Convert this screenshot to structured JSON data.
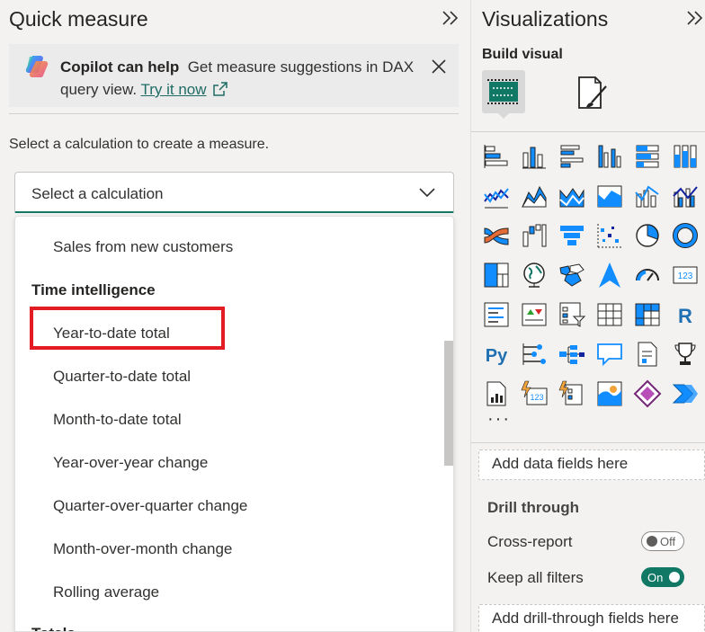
{
  "quick_measure": {
    "title": "Quick measure",
    "collapse_glyph": "»",
    "copilot": {
      "bold": "Copilot can help",
      "text": "Get measure suggestions in DAX query view.",
      "link": "Try it now"
    },
    "instruction": "Select a calculation to create a measure.",
    "select_placeholder": "Select a calculation",
    "list": {
      "items_top": [
        "Sales from new customers"
      ],
      "group_time": "Time intelligence",
      "time_items": [
        "Year-to-date total",
        "Quarter-to-date total",
        "Month-to-date total",
        "Year-over-year change",
        "Quarter-over-quarter change",
        "Month-over-month change",
        "Rolling average"
      ],
      "group_totals": "Totals",
      "highlighted": "Year-to-date total"
    }
  },
  "visualizations": {
    "title": "Visualizations",
    "collapse_glyph": "»",
    "build_label": "Build visual",
    "visual_icons": [
      "stacked-bar-chart-icon",
      "stacked-column-chart-icon",
      "clustered-bar-chart-icon",
      "clustered-column-chart-icon",
      "100-stacked-bar-chart-icon",
      "100-stacked-column-chart-icon",
      "line-chart-icon",
      "area-chart-icon",
      "stacked-area-chart-icon",
      "100-stacked-area-chart-icon",
      "line-and-stacked-column-chart-icon",
      "line-and-clustered-column-chart-icon",
      "ribbon-chart-icon",
      "waterfall-chart-icon",
      "funnel-chart-icon",
      "scatter-chart-icon",
      "pie-chart-icon",
      "donut-chart-icon",
      "treemap-icon",
      "map-icon",
      "filled-map-icon",
      "azure-map-icon",
      "gauge-icon",
      "card-icon",
      "multi-row-card-icon",
      "kpi-icon",
      "slicer-icon",
      "table-icon",
      "matrix-icon",
      "r-visual-icon",
      "python-visual-icon",
      "key-influencers-icon",
      "decomposition-tree-icon",
      "qa-icon",
      "paginated-report-icon",
      "metrics-icon",
      "narrative-icon",
      "new-card-icon",
      "new-slicer-icon",
      "arcgis-map-icon",
      "power-apps-icon",
      "power-automate-icon"
    ],
    "more_label": "···",
    "data_well": "Add data fields here",
    "drill": {
      "title": "Drill through",
      "cross_report": "Cross-report",
      "cross_report_state": "Off",
      "keep_filters": "Keep all filters",
      "keep_filters_state": "On",
      "well": "Add drill-through fields here"
    }
  },
  "colors": {
    "accent": "#117865",
    "highlight": "#e31b23",
    "chart_blue": "#118dff",
    "chart_dark": "#12239e"
  }
}
